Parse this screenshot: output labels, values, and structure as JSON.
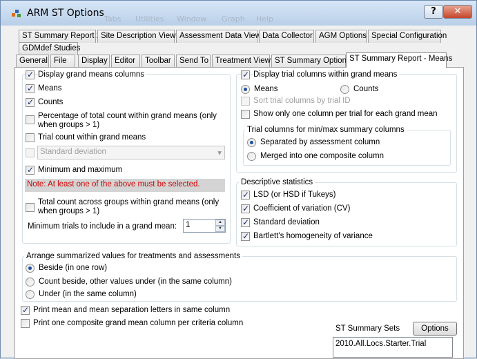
{
  "window": {
    "title": "ARM ST Options"
  },
  "ghost_menu": [
    "Tabs",
    "Utilities",
    "Window",
    "Graph",
    "Help"
  ],
  "titlebar_buttons": {
    "help": "?",
    "close": "✕"
  },
  "tabs_row1": [
    "ST Summary Report 2",
    "Site Description View",
    "Assessment Data View",
    "Data Collector",
    "AGM Options",
    "Special Configuration"
  ],
  "tabs_row2": [
    "GDMdef Studies"
  ],
  "tabs_row3": [
    "General",
    "File",
    "Display",
    "Editor",
    "Toolbar",
    "Send To",
    "Treatment View",
    "ST Summary Options",
    "ST Summary Report - Means"
  ],
  "left": {
    "display_grand_means": "Display grand means columns",
    "means": "Means",
    "counts": "Counts",
    "pct_total_l1": "Percentage of total count within grand means (only",
    "pct_total_l2": "when groups > 1)",
    "trial_count": "Trial count within grand means",
    "std_dev_combo": "Standard deviation",
    "min_max": "Minimum and maximum",
    "note": "Note: At least one of the above must be selected.",
    "total_across_l1": "Total count across groups within grand means (only",
    "total_across_l2": "when groups > 1)",
    "min_trials_label": "Minimum trials to include in a grand mean:",
    "min_trials_value": "1"
  },
  "right": {
    "display_trial_cols": "Display trial columns within grand means",
    "means": "Means",
    "counts": "Counts",
    "sort_by_id": "Sort trial columns by trial ID",
    "one_column": "Show only one column per trial for each grand mean",
    "minmax_group_title": "Trial columns for min/max summary columns",
    "separated": "Separated by assessment column",
    "merged": "Merged into one composite column"
  },
  "descriptive": {
    "title": "Descriptive statistics",
    "items": [
      "LSD (or HSD if Tukeys)",
      "Coefficient of variation (CV)",
      "Standard deviation",
      "Bartlett's homogeneity of variance"
    ]
  },
  "arrange": {
    "title": "Arrange summarized values for treatments and assessments",
    "options": [
      "Beside (in one row)",
      "Count beside, other values under (in the same column)",
      "Under (in the same column)"
    ]
  },
  "bottom": {
    "print_mean_letters": "Print mean and mean separation letters in same column",
    "print_composite": "Print one composite grand mean column per criteria column"
  },
  "summary_sets": {
    "title": "ST Summary Sets",
    "options_button": "Options",
    "items": [
      "2010.All.Locs.Starter.Trial"
    ]
  },
  "colors": {
    "note_text": "#d00000",
    "radio_dot": "#1d4fa3",
    "check": "#1a2a6e"
  }
}
